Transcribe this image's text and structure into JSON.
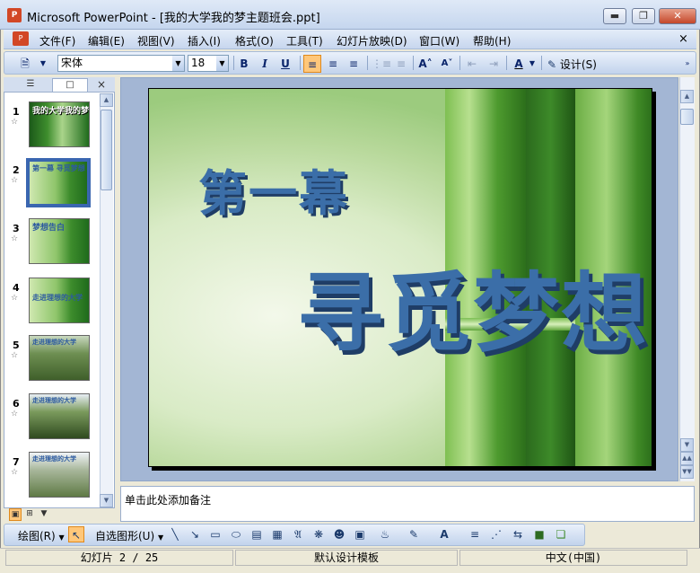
{
  "window": {
    "title": "Microsoft PowerPoint - [我的大学我的梦主题班会.ppt]",
    "app_icon_label": "P",
    "minimize_icon": "minimize-icon",
    "restore_icon": "restore-icon",
    "close_icon": "close-icon"
  },
  "menubar": {
    "items": [
      "文件(F)",
      "编辑(E)",
      "视图(V)",
      "插入(I)",
      "格式(O)",
      "工具(T)",
      "幻灯片放映(D)",
      "窗口(W)",
      "帮助(H)"
    ],
    "doc_close": "×"
  },
  "toolbar": {
    "font_name": "宋体",
    "font_size": "18",
    "bold": "B",
    "italic": "I",
    "underline": "U",
    "font_color": "A",
    "design_label": "设计(S)"
  },
  "left_pane": {
    "tab_outline_icon": "outline-icon",
    "tab_slides_icon": "slides-icon",
    "close_label": "×",
    "slides": [
      {
        "num": "1",
        "text": "我的大学我的梦"
      },
      {
        "num": "2",
        "text": "第一幕 寻觅梦想"
      },
      {
        "num": "3",
        "text": "梦想告白"
      },
      {
        "num": "4",
        "text": "走进理想的大学"
      },
      {
        "num": "5",
        "text": "走进理想的大学"
      },
      {
        "num": "6",
        "text": "走进理想的大学"
      },
      {
        "num": "7",
        "text": "走进理想的大学"
      }
    ],
    "selected_slide": 2
  },
  "slide": {
    "title": "第一幕",
    "subtitle": "寻觅梦想"
  },
  "notes": {
    "placeholder": "单击此处添加备注"
  },
  "drawbar": {
    "draw_label": "绘图(R)",
    "autoshapes_label": "自选图形(U)"
  },
  "status": {
    "slide_info": "幻灯片 2 / 25",
    "template": "默认设计模板",
    "language": "中文(中国)"
  },
  "colors": {
    "accent": "#3b6ea8",
    "toolbar_bg": "#c5d6ee"
  }
}
